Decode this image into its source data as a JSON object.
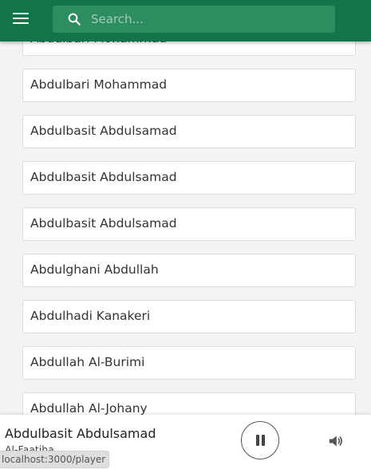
{
  "header": {
    "search_placeholder": "Search..."
  },
  "reciters": [
    "Abdulbari Mohammad",
    "Abdulbari Mohammad",
    "Abdulbasit Abdulsamad",
    "Abdulbasit Abdulsamad",
    "Abdulbasit Abdulsamad",
    "Abdulghani Abdullah",
    "Abdulhadi Kanakeri",
    "Abdullah Al-Burimi",
    "Abdullah Al-Johany"
  ],
  "player": {
    "title": "Abdulbasit Abdulsamad",
    "subtitle": "Al-Faatiha",
    "state": "playing"
  },
  "status_url": "localhost:3000/player",
  "colors": {
    "header": "#13744a",
    "search_box": "#2e8c61",
    "page_background": "#f3f3f3"
  },
  "icons": {
    "menu": "hamburger-menu-icon",
    "search": "search-icon",
    "pause": "pause-icon",
    "volume": "volume-icon"
  }
}
